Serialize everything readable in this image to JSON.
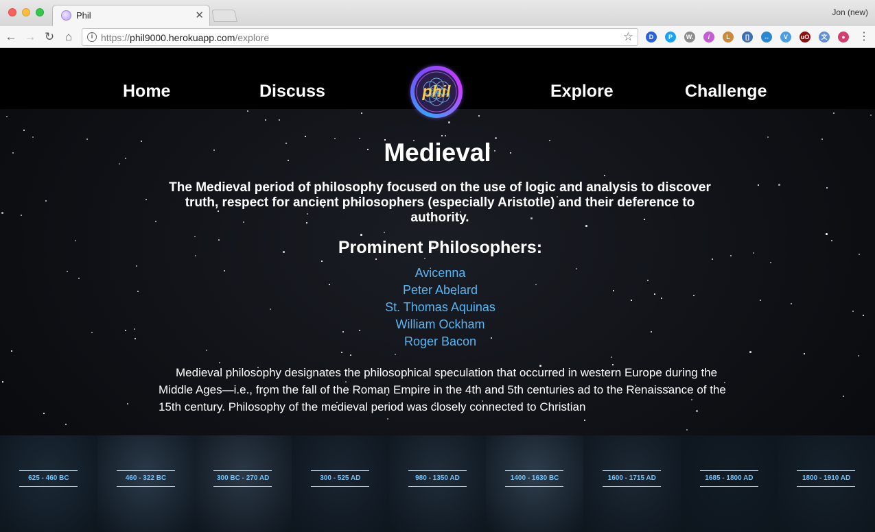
{
  "browser": {
    "tab_title": "Phil",
    "profile_name": "Jon (new)",
    "url_scheme": "https://",
    "url_host": "phil9000.herokuapp.com",
    "url_path": "/explore",
    "extensions": [
      {
        "icon": "dashlane-icon",
        "color": "#2a62d8",
        "glyph": "D"
      },
      {
        "icon": "pushbullet-icon",
        "color": "#1aa2f0",
        "glyph": "P"
      },
      {
        "icon": "wordpress-icon",
        "color": "#8c8c8c",
        "glyph": "W."
      },
      {
        "icon": "eyedropper-icon",
        "color": "#c35ed1",
        "glyph": "/"
      },
      {
        "icon": "ruler-icon",
        "color": "#c98a3c",
        "glyph": "L"
      },
      {
        "icon": "window-resizer-icon",
        "color": "#3a6fb0",
        "glyph": "[]"
      },
      {
        "icon": "swap-arrows-icon",
        "color": "#2a88d2",
        "glyph": "↔"
      },
      {
        "icon": "vimium-icon",
        "color": "#4a9ee4",
        "glyph": "V"
      },
      {
        "icon": "ublock-icon",
        "color": "#8f0d0d",
        "glyph": "uO"
      },
      {
        "icon": "translate-icon",
        "color": "#5f8fd8",
        "glyph": "文"
      },
      {
        "icon": "color-wheel-icon",
        "color": "#d23f6d",
        "glyph": "●"
      }
    ]
  },
  "nav": {
    "home": "Home",
    "discuss": "Discuss",
    "logo_text": "phil",
    "explore": "Explore",
    "challenge": "Challenge"
  },
  "era": {
    "title": "Medieval",
    "summary": "The Medieval period of philosophy focused on the use of logic and analysis to discover truth, respect for ancient philosophers (especially Aristotle) and their deference to authority.",
    "philosophers_heading": "Prominent Philosophers:",
    "philosophers": [
      "Avicenna",
      "Peter Abelard",
      "St. Thomas Aquinas",
      "William Ockham",
      "Roger Bacon"
    ],
    "description": "Medieval philosophy designates the philosophical speculation that occurred in western Europe during the Middle Ages—i.e., from the fall of the Roman Empire in the 4th and 5th centuries ad to the Renaissance of the 15th century. Philosophy of the medieval period was closely connected to Christian"
  },
  "timeline": [
    {
      "label": "625 - 460 BC",
      "tint": "#1b2a37"
    },
    {
      "label": "460 - 322 BC",
      "tint": "#2a3a4a"
    },
    {
      "label": "300 BC - 270 AD",
      "tint": "#2b3846"
    },
    {
      "label": "300 - 525 AD",
      "tint": "#1a2531"
    },
    {
      "label": "980 - 1350 AD",
      "tint": "#202d3a"
    },
    {
      "label": "1400 - 1630 BC",
      "tint": "#2e3e4d"
    },
    {
      "label": "1600 - 1715 AD",
      "tint": "#1c2834"
    },
    {
      "label": "1685 - 1800 AD",
      "tint": "#121c25"
    },
    {
      "label": "1800 - 1910 AD",
      "tint": "#16212b"
    }
  ]
}
